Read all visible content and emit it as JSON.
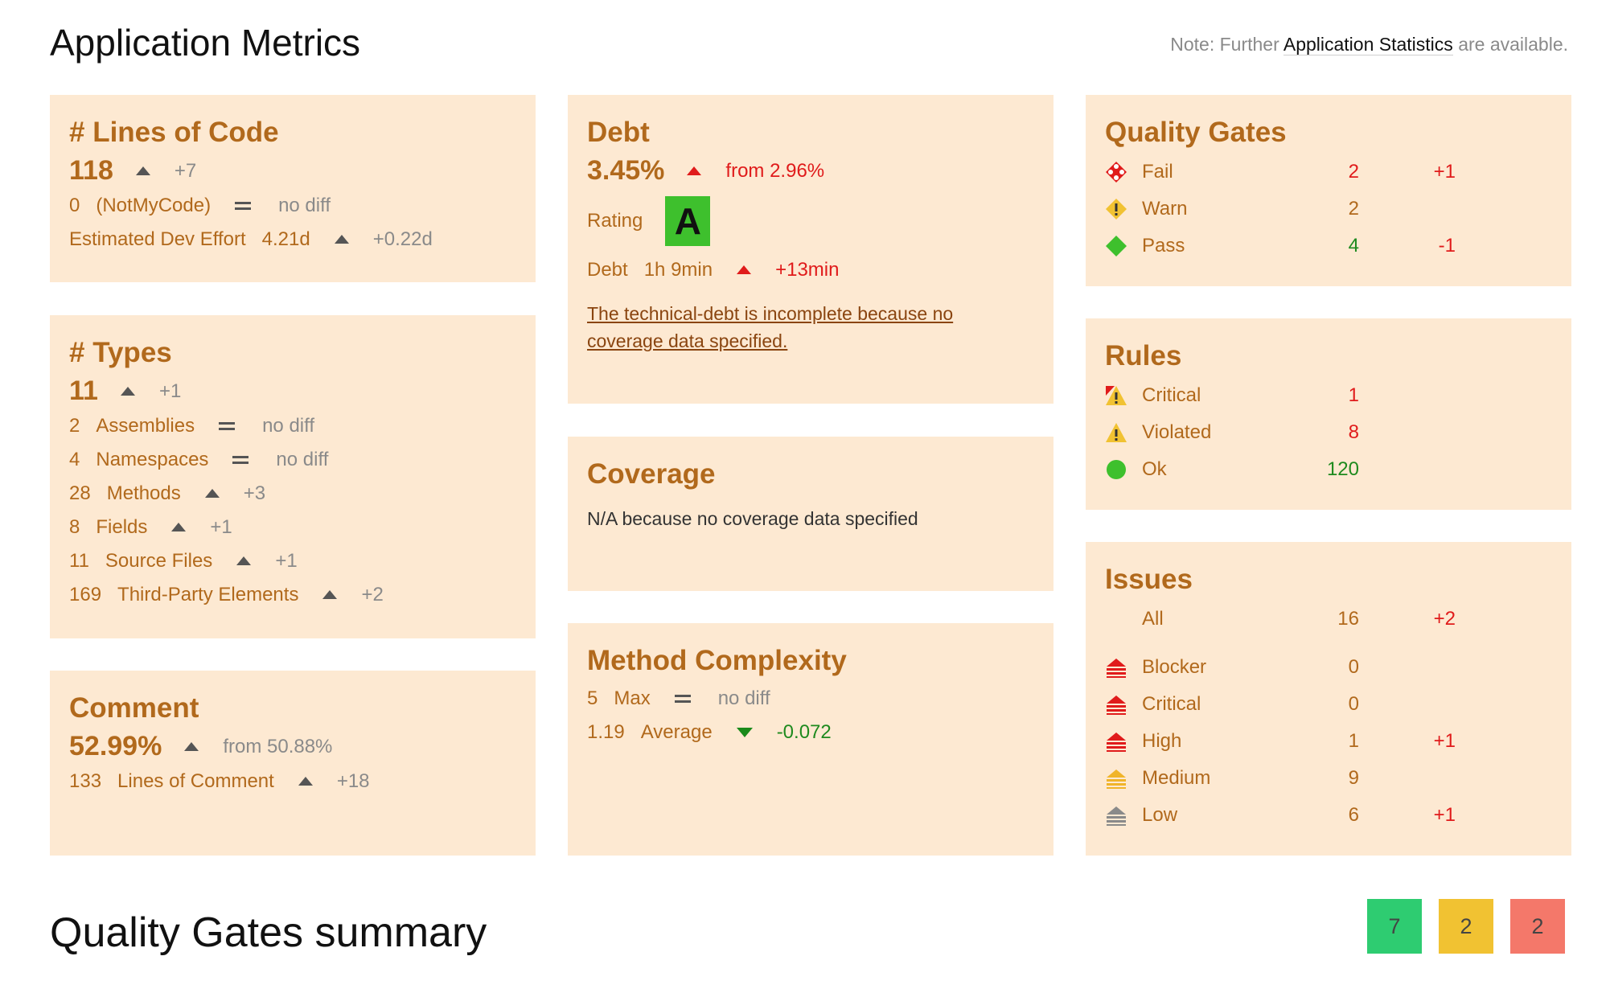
{
  "header": {
    "title": "Application Metrics",
    "note_prefix": "Note: Further",
    "note_link": "Application Statistics",
    "note_suffix": "are available."
  },
  "loc": {
    "title": "# Lines of Code",
    "value": "118",
    "delta": "+7",
    "notmycode_num": "0",
    "notmycode_label": "(NotMyCode)",
    "notmycode_diff": "no diff",
    "effort_label": "Estimated Dev Effort",
    "effort_value": "4.21d",
    "effort_delta": "+0.22d"
  },
  "types": {
    "title": "# Types",
    "value": "11",
    "delta": "+1",
    "rows": [
      {
        "num": "2",
        "label": "Assemblies",
        "diff": "no diff",
        "kind": "eq"
      },
      {
        "num": "4",
        "label": "Namespaces",
        "diff": "no diff",
        "kind": "eq"
      },
      {
        "num": "28",
        "label": "Methods",
        "diff": "+3",
        "kind": "up"
      },
      {
        "num": "8",
        "label": "Fields",
        "diff": "+1",
        "kind": "up"
      },
      {
        "num": "11",
        "label": "Source Files",
        "diff": "+1",
        "kind": "up"
      },
      {
        "num": "169",
        "label": "Third-Party Elements",
        "diff": "+2",
        "kind": "up"
      }
    ]
  },
  "comment": {
    "title": "Comment",
    "value": "52.99%",
    "from": "from 50.88%",
    "lines_num": "133",
    "lines_label": "Lines of Comment",
    "lines_delta": "+18"
  },
  "debt": {
    "title": "Debt",
    "value": "3.45%",
    "from": "from 2.96%",
    "rating_label": "Rating",
    "rating": "A",
    "debt_label": "Debt",
    "debt_value": "1h 9min",
    "debt_delta": "+13min",
    "warning_link": "The technical-debt is incomplete because no coverage data specified."
  },
  "coverage": {
    "title": "Coverage",
    "text": "N/A because no coverage data specified"
  },
  "complexity": {
    "title": "Method Complexity",
    "max_num": "5",
    "max_label": "Max",
    "max_diff": "no diff",
    "avg_num": "1.19",
    "avg_label": "Average",
    "avg_delta": "-0.072"
  },
  "quality_gates": {
    "title": "Quality Gates",
    "rows": [
      {
        "icon": "fail-icon",
        "label": "Fail",
        "value": "2",
        "delta": "+1",
        "value_color": "#e01b1b",
        "delta_color": "#e01b1b"
      },
      {
        "icon": "warn-icon",
        "label": "Warn",
        "value": "2",
        "delta": "",
        "value_color": "#b1691c",
        "delta_color": "#b1691c"
      },
      {
        "icon": "pass-icon",
        "label": "Pass",
        "value": "4",
        "delta": "-1",
        "value_color": "#1e8a1e",
        "delta_color": "#e01b1b"
      }
    ]
  },
  "rules": {
    "title": "Rules",
    "rows": [
      {
        "icon": "critical-rule-icon",
        "label": "Critical",
        "value": "1",
        "value_color": "#e01b1b"
      },
      {
        "icon": "violated-rule-icon",
        "label": "Violated",
        "value": "8",
        "value_color": "#e01b1b"
      },
      {
        "icon": "ok-rule-icon",
        "label": "Ok",
        "value": "120",
        "value_color": "#1e8a1e"
      }
    ]
  },
  "issues": {
    "title": "Issues",
    "all_label": "All",
    "all_value": "16",
    "all_delta": "+2",
    "rows": [
      {
        "icon": "blocker-icon",
        "label": "Blocker",
        "value": "0",
        "delta": "",
        "color": "#e01b1b"
      },
      {
        "icon": "critical-icon",
        "label": "Critical",
        "value": "0",
        "delta": "",
        "color": "#e01b1b"
      },
      {
        "icon": "high-icon",
        "label": "High",
        "value": "1",
        "delta": "+1",
        "color": "#e01b1b"
      },
      {
        "icon": "medium-icon",
        "label": "Medium",
        "value": "9",
        "delta": "",
        "color": "#f0b429"
      },
      {
        "icon": "low-icon",
        "label": "Low",
        "value": "6",
        "delta": "+1",
        "color": "#8a8a8a"
      }
    ]
  },
  "summary": {
    "title": "Quality Gates summary",
    "pass_count": "7",
    "warn_count": "2",
    "fail_count": "2",
    "colors": {
      "pass": "#2ecc71",
      "warn": "#f1c232",
      "fail": "#f4786a"
    }
  }
}
